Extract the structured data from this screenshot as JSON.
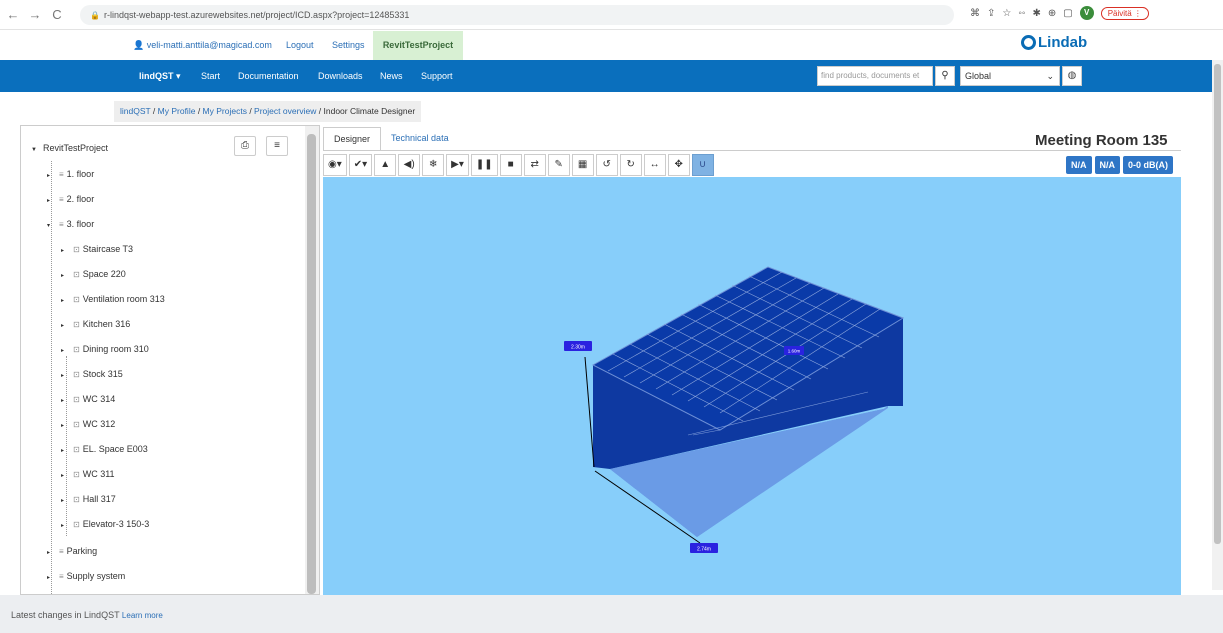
{
  "browser": {
    "url": "r-lindqst-webapp-test.azurewebsites.net/project/ICD.aspx?project=12485331",
    "update_label": "Päivitä"
  },
  "topline": {
    "user_email": "veli-matti.anttila@magicad.com",
    "logout": "Logout",
    "settings": "Settings",
    "project": "RevitTestProject",
    "brand": "Lindab"
  },
  "navbar": {
    "brand": "lindQST ▾",
    "items": [
      "Start",
      "Documentation",
      "Downloads",
      "News",
      "Support"
    ],
    "search_placeholder": "find products, documents et",
    "region": "Global"
  },
  "breadcrumb": {
    "links": [
      "lindQST",
      "My Profile",
      "My Projects",
      "Project overview"
    ],
    "current": "Indoor Climate Designer"
  },
  "tree": {
    "root": "RevitTestProject",
    "floors": [
      "1. floor",
      "2. floor",
      "3. floor"
    ],
    "spaces": [
      "Staircase T3",
      "Space 220",
      "Ventilation room 313",
      "Kitchen 316",
      "Dining room 310",
      "Stock 315",
      "WC 314",
      "WC 312",
      "EL. Space E003",
      "WC 311",
      "Hall 317",
      "Elevator-3 150-3"
    ],
    "after": [
      "Parking",
      "Supply system"
    ]
  },
  "designer": {
    "tabs": [
      "Designer",
      "Technical data"
    ],
    "room_title": "Meeting Room 135",
    "badges": [
      "N/A",
      "N/A",
      "0-0 dB(A)"
    ],
    "dims": {
      "height": "2.30m",
      "width": "2.74m",
      "depth": "1.60m"
    }
  },
  "footer": {
    "text": "Latest changes in LindQST",
    "link": "Learn more"
  },
  "colors": {
    "nav": "#0a6fbd",
    "canvas": "#87cefa",
    "room": "#032d99"
  }
}
